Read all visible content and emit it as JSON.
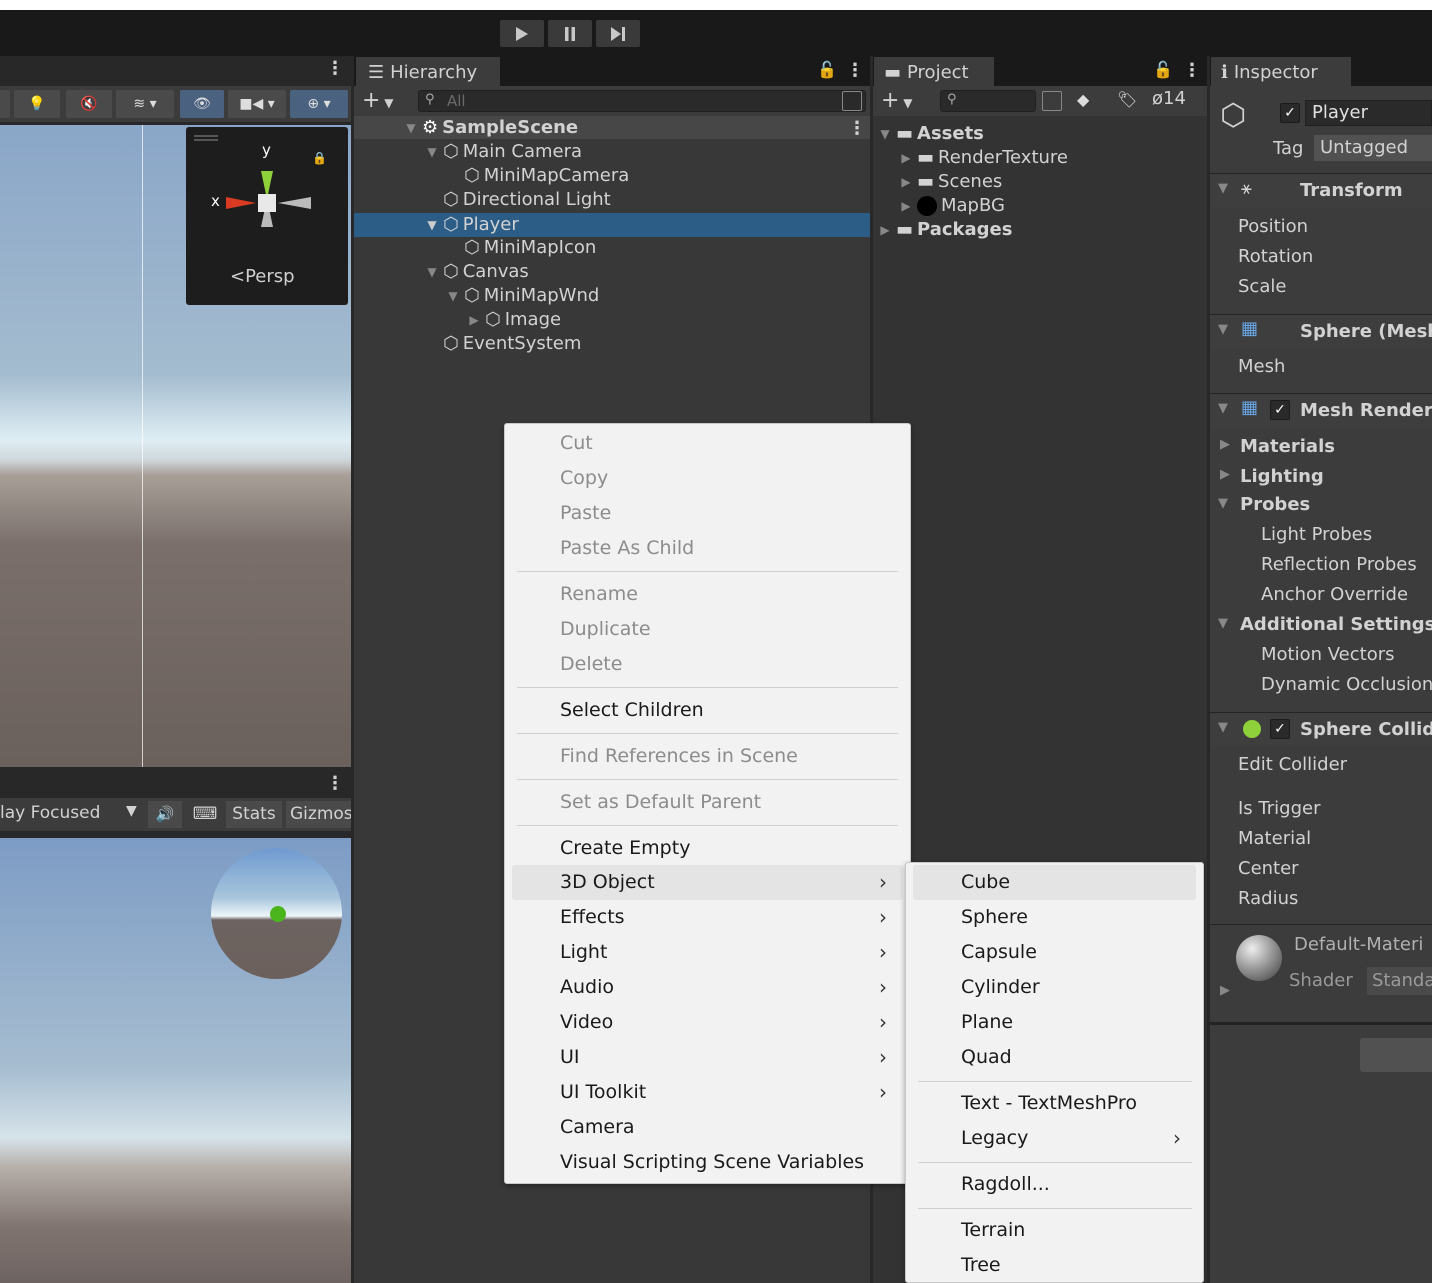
{
  "hierarchy": {
    "tab": "Hierarchy",
    "search_placeholder": "All",
    "rows": [
      {
        "label": "SampleScene"
      },
      {
        "label": "Main Camera"
      },
      {
        "label": "MiniMapCamera"
      },
      {
        "label": "Directional Light"
      },
      {
        "label": "Player"
      },
      {
        "label": "MiniMapIcon"
      },
      {
        "label": "Canvas"
      },
      {
        "label": "MiniMapWnd"
      },
      {
        "label": "Image"
      },
      {
        "label": "EventSystem"
      }
    ]
  },
  "project": {
    "tab": "Project",
    "hidden_count": "14",
    "items": [
      {
        "label": "Assets"
      },
      {
        "label": "RenderTexture"
      },
      {
        "label": "Scenes"
      },
      {
        "label": "MapBG"
      },
      {
        "label": "Packages"
      }
    ]
  },
  "scene": {
    "gizmo_y": "y",
    "gizmo_x": "x",
    "persp": "Persp"
  },
  "game": {
    "focus_mode": "lay Focused",
    "stats": "Stats",
    "gizmos": "Gizmos"
  },
  "inspector": {
    "tab": "Inspector",
    "object_name": "Player",
    "tag_label": "Tag",
    "tag_value": "Untagged",
    "transform": {
      "title": "Transform",
      "position": "Position",
      "rotation": "Rotation",
      "scale": "Scale"
    },
    "mesh_filter": {
      "title": "Sphere (Mesh",
      "mesh": "Mesh"
    },
    "mesh_renderer": {
      "title": "Mesh Rendere",
      "materials": "Materials",
      "lighting": "Lighting",
      "probes": "Probes",
      "light_probes": "Light Probes",
      "reflection_probes": "Reflection Probes",
      "anchor_override": "Anchor Override",
      "additional_settings": "Additional Settings",
      "motion_vectors": "Motion Vectors",
      "dynamic_occlusion": "Dynamic Occlusion"
    },
    "sphere_collider": {
      "title": "Sphere Collide",
      "edit_collider": "Edit Collider",
      "is_trigger": "Is Trigger",
      "material": "Material",
      "center": "Center",
      "radius": "Radius"
    },
    "material_preview": {
      "name": "Default-Materi",
      "shader_label": "Shader",
      "shader_value": "Standa"
    }
  },
  "context_menu": {
    "items": [
      {
        "label": "Cut"
      },
      {
        "label": "Copy"
      },
      {
        "label": "Paste"
      },
      {
        "label": "Paste As Child"
      },
      {
        "label": "Rename"
      },
      {
        "label": "Duplicate"
      },
      {
        "label": "Delete"
      },
      {
        "label": "Select Children"
      },
      {
        "label": "Find References in Scene"
      },
      {
        "label": "Set as Default Parent"
      },
      {
        "label": "Create Empty"
      },
      {
        "label": "3D Object"
      },
      {
        "label": "Effects"
      },
      {
        "label": "Light"
      },
      {
        "label": "Audio"
      },
      {
        "label": "Video"
      },
      {
        "label": "UI"
      },
      {
        "label": "UI Toolkit"
      },
      {
        "label": "Camera"
      },
      {
        "label": "Visual Scripting Scene Variables"
      }
    ]
  },
  "submenu": {
    "items": [
      {
        "label": "Cube"
      },
      {
        "label": "Sphere"
      },
      {
        "label": "Capsule"
      },
      {
        "label": "Cylinder"
      },
      {
        "label": "Plane"
      },
      {
        "label": "Quad"
      },
      {
        "label": "Text - TextMeshPro"
      },
      {
        "label": "Legacy"
      },
      {
        "label": "Ragdoll..."
      },
      {
        "label": "Terrain"
      },
      {
        "label": "Tree"
      }
    ]
  }
}
